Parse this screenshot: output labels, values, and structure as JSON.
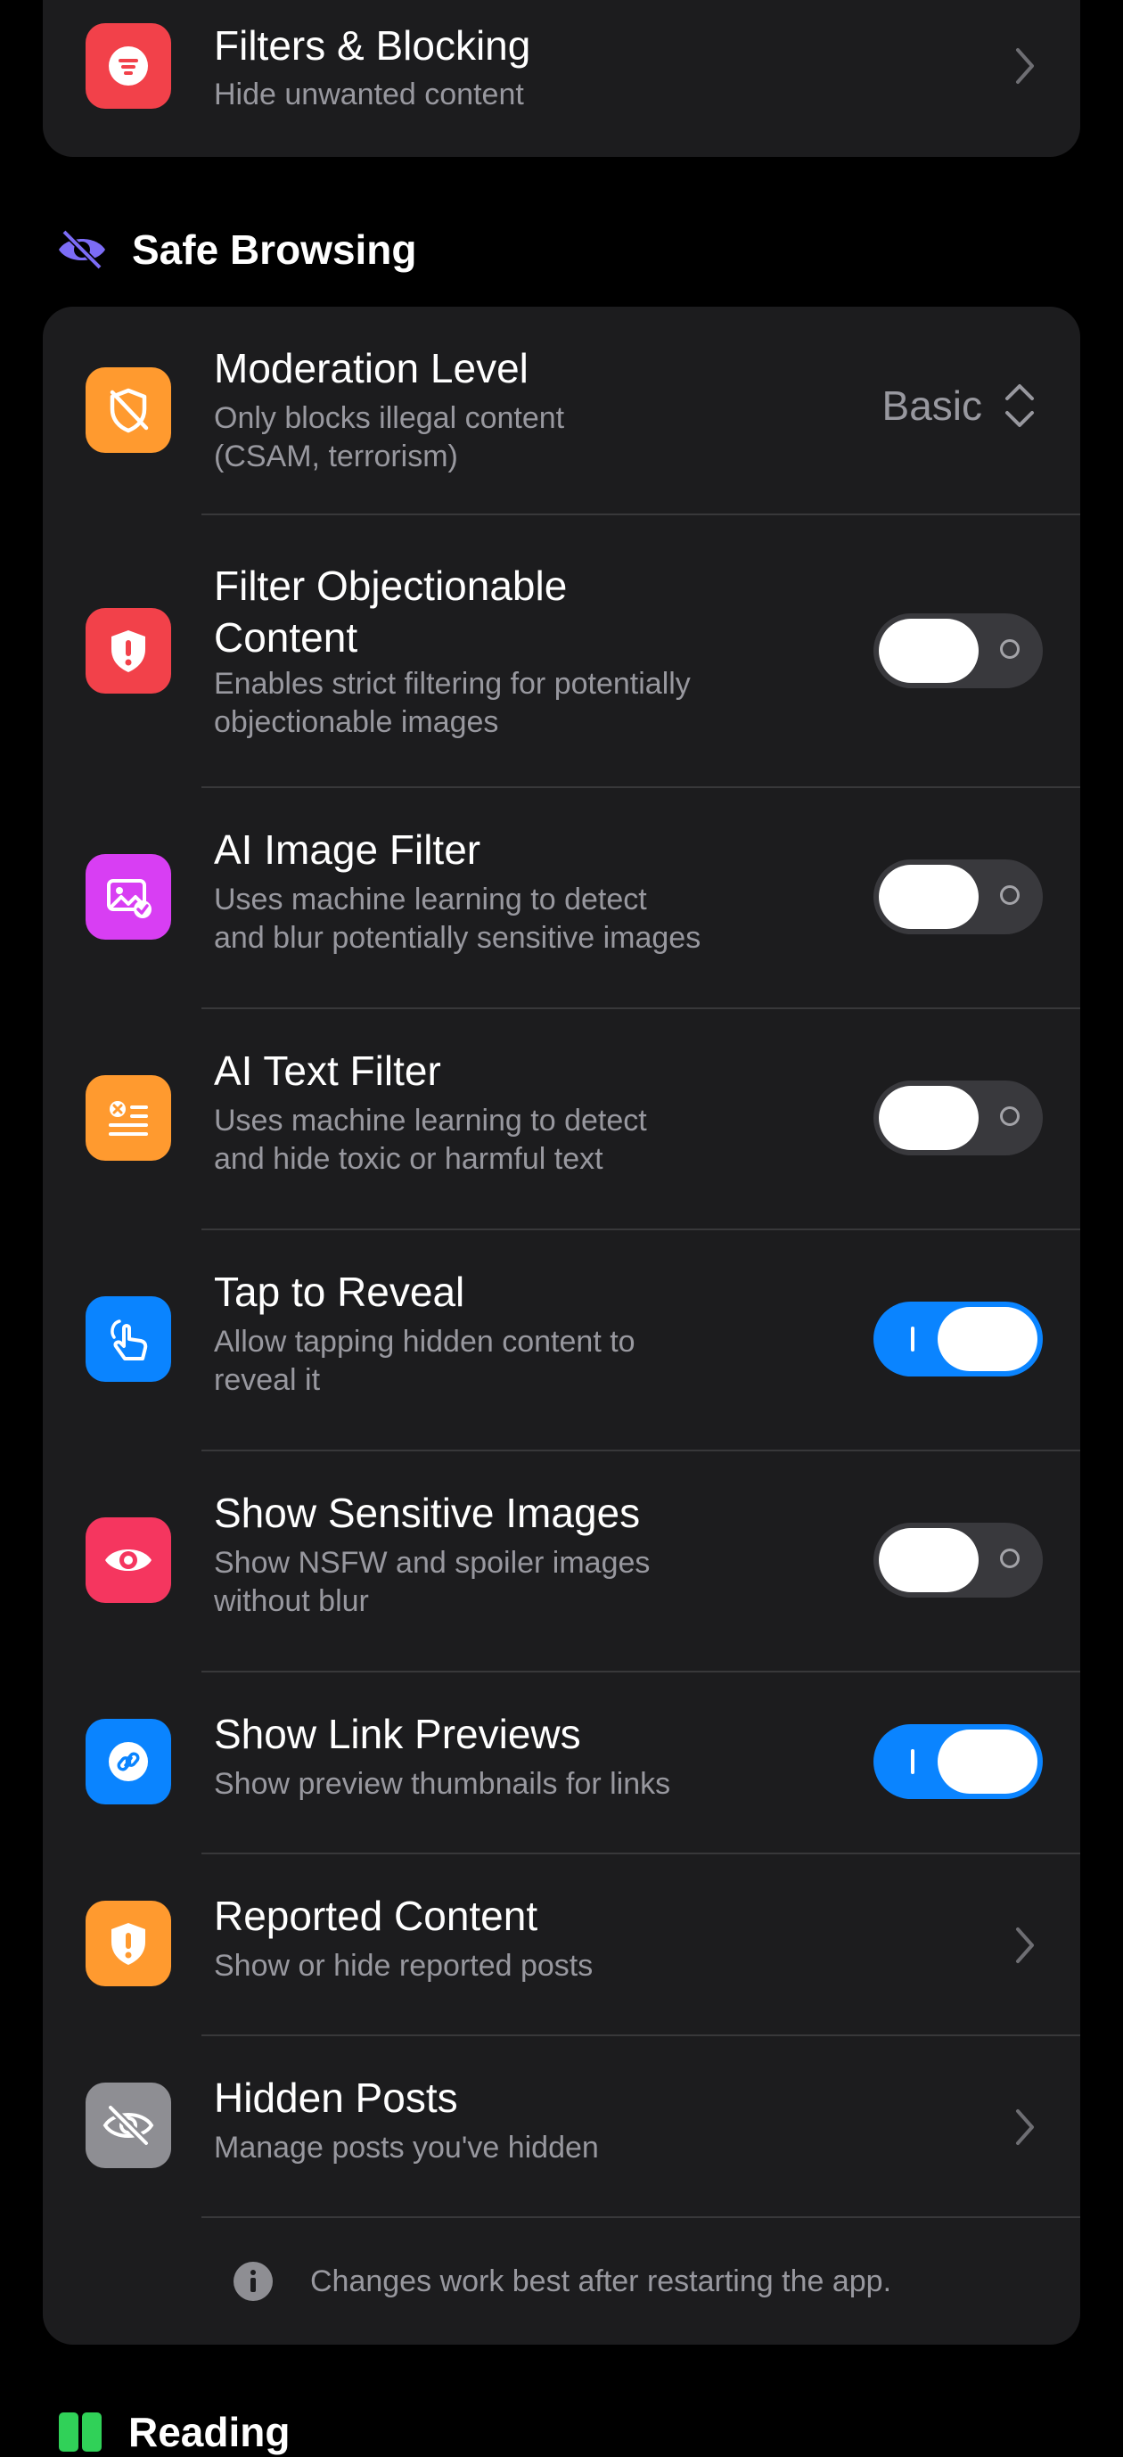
{
  "colors": {
    "background": "#000000",
    "card": "#1c1c1e",
    "accent_blue": "#0a84ff",
    "secondary_text": "#98989f",
    "red": "#f2414a",
    "orange": "#ff9a2f",
    "purple": "#d83ef3",
    "pink": "#f5365f",
    "gray": "#8e8e93",
    "green": "#30d158"
  },
  "filters_row": {
    "icon": "filter-lines-icon",
    "title": "Filters & Blocking",
    "subtitle": "Hide unwanted content"
  },
  "safe_browsing": {
    "header_icon": "eye-slash-icon",
    "header": "Safe Browsing",
    "moderation": {
      "icon": "shield-slash-icon",
      "title": "Moderation Level",
      "subtitle": "Only blocks illegal content\n(CSAM, terrorism)",
      "value": "Basic"
    },
    "toggles": [
      {
        "icon": "shield-exclamation-icon",
        "title": "Filter Objectionable\nContent",
        "subtitle": "Enables strict filtering for potentially\nobjectionable images",
        "on": false
      },
      {
        "icon": "photo-checkmark-icon",
        "title": "AI Image Filter",
        "subtitle": "Uses machine learning to detect\nand blur potentially sensitive images",
        "on": false
      },
      {
        "icon": "text-x-icon",
        "title": "AI Text Filter",
        "subtitle": "Uses machine learning to detect\nand hide toxic or harmful text",
        "on": false
      },
      {
        "icon": "hand-tap-icon",
        "title": "Tap to Reveal",
        "subtitle": "Allow tapping hidden content to\nreveal it",
        "on": true
      },
      {
        "icon": "eye-icon",
        "title": "Show Sensitive Images",
        "subtitle": "Show NSFW and spoiler images\nwithout blur",
        "on": false
      },
      {
        "icon": "link-icon",
        "title": "Show Link Previews",
        "subtitle": "Show preview thumbnails for links",
        "on": true
      }
    ],
    "reported": {
      "icon": "shield-exclamation-icon",
      "title": "Reported Content",
      "subtitle": "Show or hide reported posts"
    },
    "hidden": {
      "icon": "eye-slash-icon",
      "title": "Hidden Posts",
      "subtitle": "Manage posts you've hidden"
    },
    "footer_icon": "info-icon",
    "footer_note": "Changes work best after restarting the app."
  },
  "reading": {
    "header_icon": "book-icon",
    "header": "Reading"
  }
}
